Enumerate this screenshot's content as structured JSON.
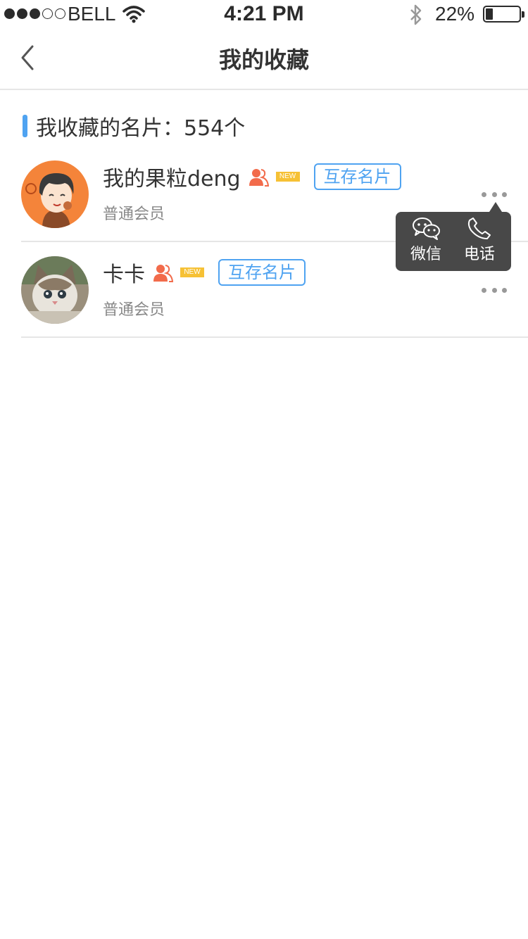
{
  "status_bar": {
    "carrier": "BELL",
    "time": "4:21 PM",
    "battery": "22%",
    "battery_level": 0.22,
    "signal_bars_filled": 3,
    "signal_bars_total": 5
  },
  "nav": {
    "title": "我的收藏",
    "back_icon": "chevron-left-icon"
  },
  "section": {
    "label": "我收藏的名片：",
    "count": "554个",
    "accent_color": "#4fa3f1"
  },
  "cards": [
    {
      "name": "我的果粒deng",
      "new_label": "NEW",
      "tag": "互存名片",
      "level": "普通会员",
      "avatar": "cartoon-boy-avatar"
    },
    {
      "name": "卡卡",
      "new_label": "NEW",
      "tag": "互存名片",
      "level": "普通会员",
      "avatar": "kitten-avatar"
    }
  ],
  "popup": {
    "wechat_label": "微信",
    "phone_label": "电话"
  },
  "colors": {
    "tag_blue": "#4fa3f1",
    "person_icon_orange": "#f26b4b",
    "new_badge_yellow": "#f6c135",
    "popup_bg": "#484848"
  }
}
